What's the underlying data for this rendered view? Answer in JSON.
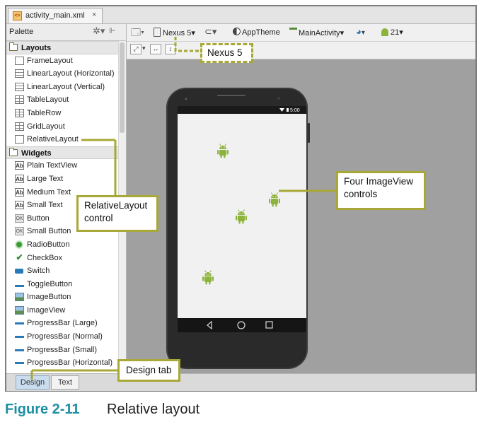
{
  "editor": {
    "file_tab": {
      "icon": "xml-file-icon",
      "name": "activity_main.xml",
      "close": "×"
    }
  },
  "palette": {
    "title": "Palette",
    "sections": [
      {
        "label": "Layouts",
        "items": [
          {
            "label": "FrameLayout",
            "icon": "frame-layout-icon"
          },
          {
            "label": "LinearLayout (Horizontal)",
            "icon": "linear-horizontal-icon"
          },
          {
            "label": "LinearLayout (Vertical)",
            "icon": "linear-vertical-icon"
          },
          {
            "label": "TableLayout",
            "icon": "table-layout-icon"
          },
          {
            "label": "TableRow",
            "icon": "table-row-icon"
          },
          {
            "label": "GridLayout",
            "icon": "grid-layout-icon"
          },
          {
            "label": "RelativeLayout",
            "icon": "relative-layout-icon"
          }
        ]
      },
      {
        "label": "Widgets",
        "items": [
          {
            "label": "Plain TextView",
            "icon": "ab-text-icon",
            "glyph": "Ab"
          },
          {
            "label": "Large Text",
            "icon": "ab-text-icon",
            "glyph": "Ab"
          },
          {
            "label": "Medium Text",
            "icon": "ab-text-icon",
            "glyph": "Ab"
          },
          {
            "label": "Small Text",
            "icon": "ab-text-icon",
            "glyph": "Ab"
          },
          {
            "label": "Button",
            "icon": "button-icon",
            "glyph": "OK"
          },
          {
            "label": "Small Button",
            "icon": "small-button-icon",
            "glyph": "OK"
          },
          {
            "label": "RadioButton",
            "icon": "radio-button-icon"
          },
          {
            "label": "CheckBox",
            "icon": "checkbox-icon",
            "glyph": "✔"
          },
          {
            "label": "Switch",
            "icon": "switch-icon"
          },
          {
            "label": "ToggleButton",
            "icon": "toggle-button-icon"
          },
          {
            "label": "ImageButton",
            "icon": "image-button-icon"
          },
          {
            "label": "ImageView",
            "icon": "image-view-icon"
          },
          {
            "label": "ProgressBar (Large)",
            "icon": "progress-bar-icon"
          },
          {
            "label": "ProgressBar (Normal)",
            "icon": "progress-bar-icon"
          },
          {
            "label": "ProgressBar (Small)",
            "icon": "progress-bar-icon"
          },
          {
            "label": "ProgressBar (Horizontal)",
            "icon": "progress-bar-icon"
          }
        ]
      }
    ]
  },
  "toolbar": {
    "device": "Nexus 5▾",
    "theme": "AppTheme",
    "activity": "MainActivity▾",
    "api": "21▾"
  },
  "phone": {
    "status_time": "5:00"
  },
  "bottom_tabs": {
    "design": "Design",
    "text": "Text"
  },
  "callouts": {
    "nexus": "Nexus 5",
    "relative": "RelativeLayout control",
    "imageview": "Four ImageView controls",
    "design": "Design tab"
  },
  "caption": {
    "figure": "Figure 2-11",
    "title": "Relative layout"
  },
  "colors": {
    "callout_border": "#a8a838",
    "caption_accent": "#1e8fa3",
    "android_green": "#8cb33c"
  }
}
